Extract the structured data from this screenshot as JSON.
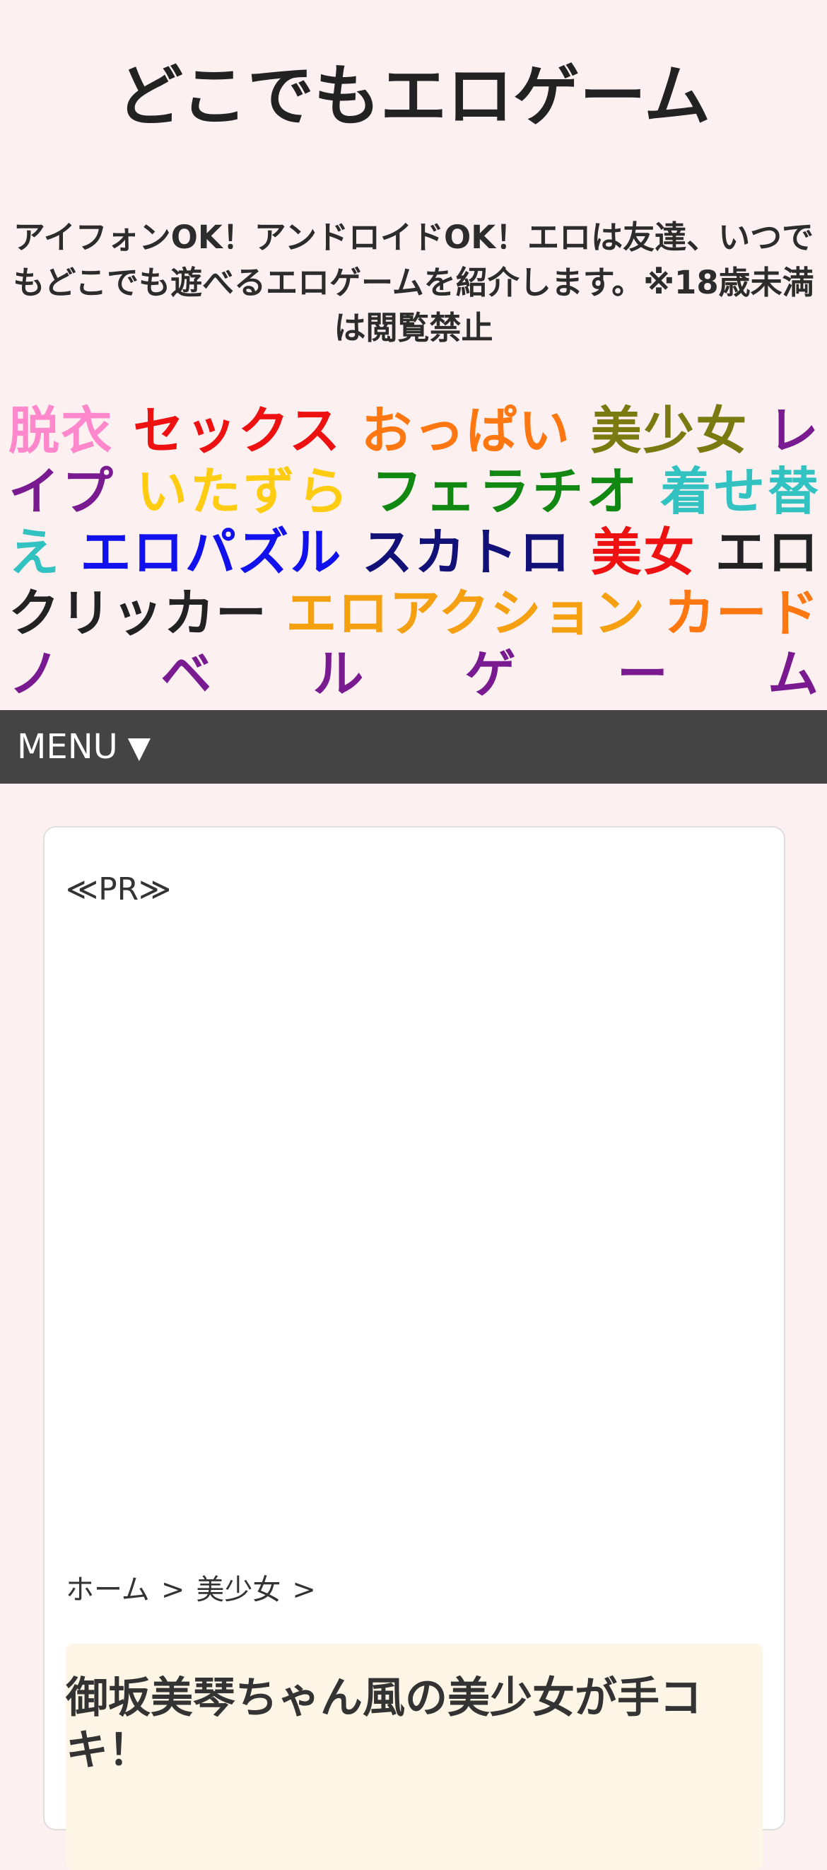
{
  "site": {
    "title": "どこでもエロゲーム",
    "description": "アイフォンOK！アンドロイドOK！エロは友達、いつでもどこでも遊べるエロゲームを紹介します。※18歳未満は閲覧禁止"
  },
  "tags": [
    {
      "label": "脱衣",
      "color": "#ff88cc"
    },
    {
      "label": "セックス",
      "color": "#ee1111"
    },
    {
      "label": "おっぱい",
      "color": "#ff7711"
    },
    {
      "label": "美少女",
      "color": "#7a7a10"
    },
    {
      "label": "レイプ",
      "color": "#7a1a90"
    },
    {
      "label": "いたずら",
      "color": "#ffcc11"
    },
    {
      "label": "フェラチオ",
      "color": "#118811"
    },
    {
      "label": "着せ替え",
      "color": "#33c2c2"
    },
    {
      "label": "エロパズル",
      "color": "#1111ee"
    },
    {
      "label": "スカトロ",
      "color": "#111177"
    },
    {
      "label": "美女",
      "color": "#ee1111"
    },
    {
      "label": "エロクリッカー",
      "color": "#222222"
    },
    {
      "label": "エロアクション",
      "color": "#f5a010"
    },
    {
      "label": "カード",
      "color": "#ff7711"
    },
    {
      "label": "ノベルゲーム",
      "color": "#7a1a90"
    }
  ],
  "menu": {
    "label": "MENU",
    "arrow": "▼"
  },
  "content": {
    "pr_label": "≪PR≫",
    "breadcrumb": {
      "home": "ホーム",
      "category": "美少女",
      "separator": ">"
    },
    "post_title": "御坂美琴ちゃん風の美少女が手コキ！"
  }
}
